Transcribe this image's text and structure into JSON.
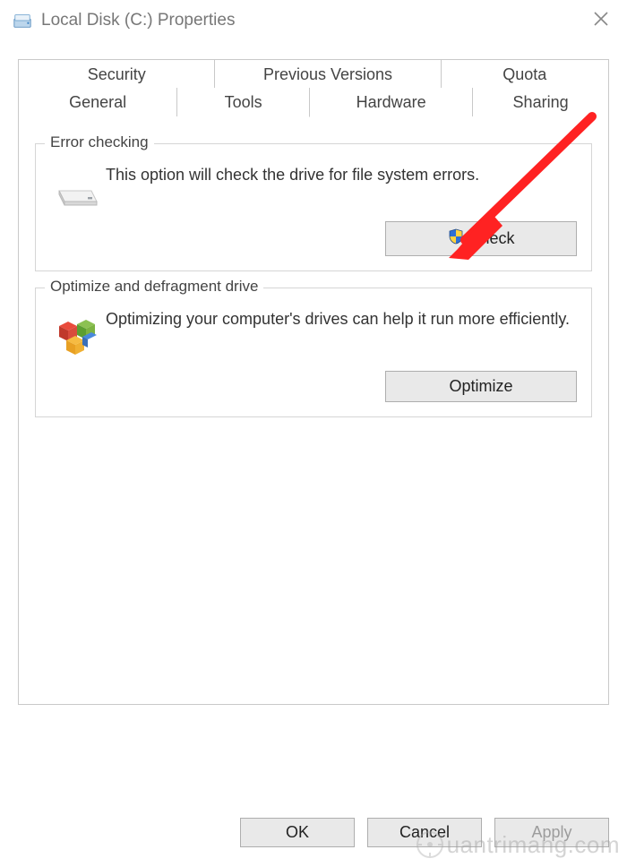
{
  "window": {
    "title": "Local Disk (C:) Properties"
  },
  "tabs_row1": [
    {
      "label": "Security"
    },
    {
      "label": "Previous Versions"
    },
    {
      "label": "Quota"
    }
  ],
  "tabs_row2": [
    {
      "label": "General"
    },
    {
      "label": "Tools",
      "active": true
    },
    {
      "label": "Hardware"
    },
    {
      "label": "Sharing"
    }
  ],
  "groups": {
    "error_checking": {
      "title": "Error checking",
      "text": "This option will check the drive for file system errors.",
      "button": "Check"
    },
    "optimize": {
      "title": "Optimize and defragment drive",
      "text": "Optimizing your computer's drives can help it run more efficiently.",
      "button": "Optimize"
    }
  },
  "footer": {
    "ok": "OK",
    "cancel": "Cancel",
    "apply": "Apply"
  },
  "watermark": "uantrimang.com"
}
